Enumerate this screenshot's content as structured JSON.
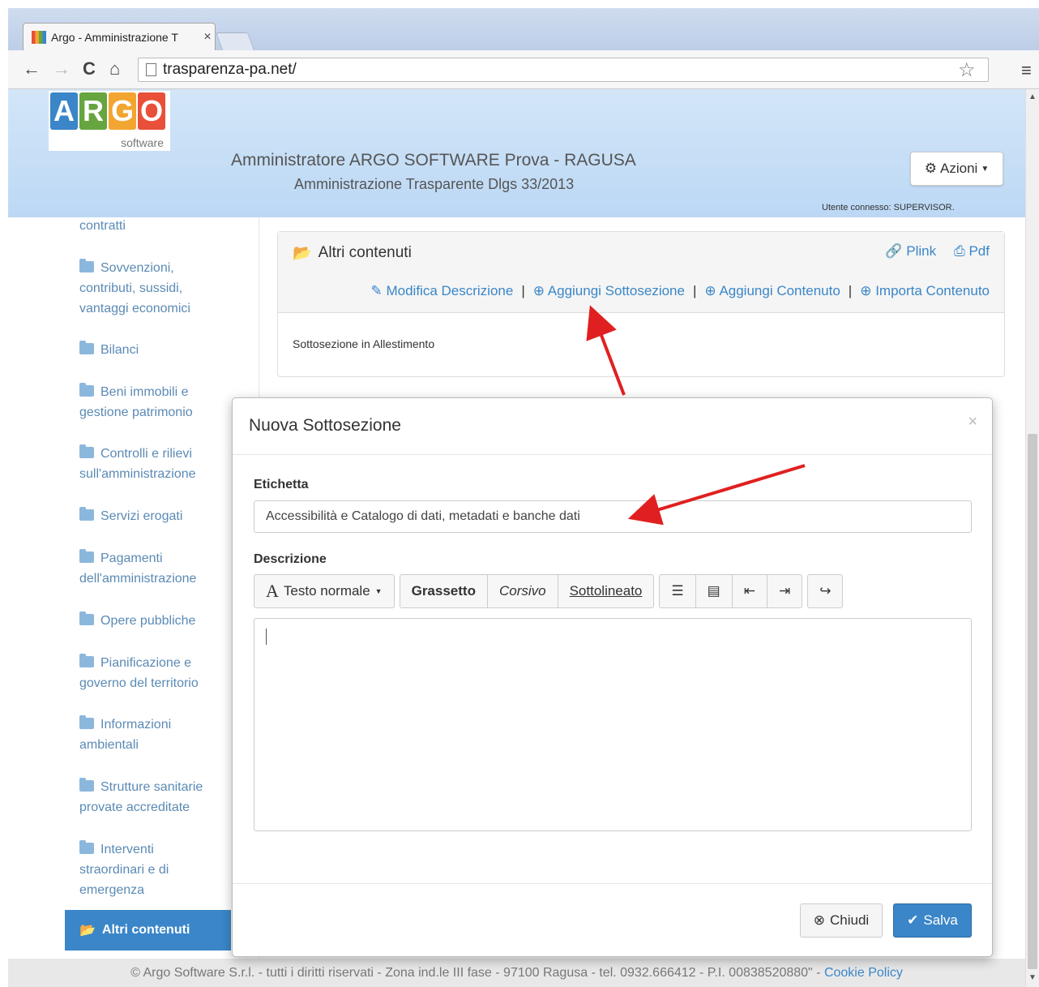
{
  "browser": {
    "tab_title": "Argo - Amministrazione T",
    "tab_close": "×",
    "url": "trasparenza-pa.net/"
  },
  "header": {
    "logo_letters": [
      "A",
      "R",
      "G",
      "O"
    ],
    "logo_colors": [
      "#3a86c8",
      "#66a53f",
      "#f2a531",
      "#e8503a"
    ],
    "logo_sub": "software",
    "title": "Amministratore ARGO SOFTWARE Prova - RAGUSA",
    "subtitle": "Amministrazione Trasparente Dlgs 33/2013",
    "actions_label": "Azioni",
    "user_connected": "Utente connesso: SUPERVISOR."
  },
  "sidebar": {
    "items": [
      {
        "label": "contratti"
      },
      {
        "label": "Sovvenzioni, contributi, sussidi, vantaggi economici"
      },
      {
        "label": "Bilanci"
      },
      {
        "label": "Beni immobili e gestione patrimonio"
      },
      {
        "label": "Controlli e rilievi sull'amministrazione"
      },
      {
        "label": "Servizi erogati"
      },
      {
        "label": "Pagamenti dell'amministrazione"
      },
      {
        "label": "Opere pubbliche"
      },
      {
        "label": "Pianificazione e governo del territorio"
      },
      {
        "label": "Informazioni ambientali"
      },
      {
        "label": "Strutture sanitarie provate accreditate"
      },
      {
        "label": "Interventi straordinari e di emergenza"
      }
    ],
    "active_label": "Altri contenuti"
  },
  "panel": {
    "title": "Altri contenuti",
    "plink": "Plink",
    "pdf": "Pdf",
    "actions": [
      "Modifica Descrizione",
      "Aggiungi Sottosezione",
      "Aggiungi Contenuto",
      "Importa Contenuto"
    ],
    "separator": "|",
    "body": "Sottosezione in Allestimento"
  },
  "modal": {
    "title": "Nuova Sottosezione",
    "close": "×",
    "label_etichetta": "Etichetta",
    "etichetta_value": "Accessibilità e Catalogo di dati, metadati e banche dati",
    "label_descrizione": "Descrizione",
    "toolbar": {
      "style_icon": "A",
      "style": "Testo normale",
      "bold": "Grassetto",
      "italic": "Corsivo",
      "underline": "Sottolineato"
    },
    "btn_close": "Chiudi",
    "btn_save": "Salva"
  },
  "footer": {
    "text": "© Argo Software S.r.l. - tutti i diritti riservati - Zona ind.le III fase - 97100 Ragusa - tel. 0932.666412 - P.I. 00838520880\" - ",
    "link": "Cookie Policy"
  },
  "colors": {
    "accent": "#3a86c8",
    "arrow": "#e02020"
  }
}
